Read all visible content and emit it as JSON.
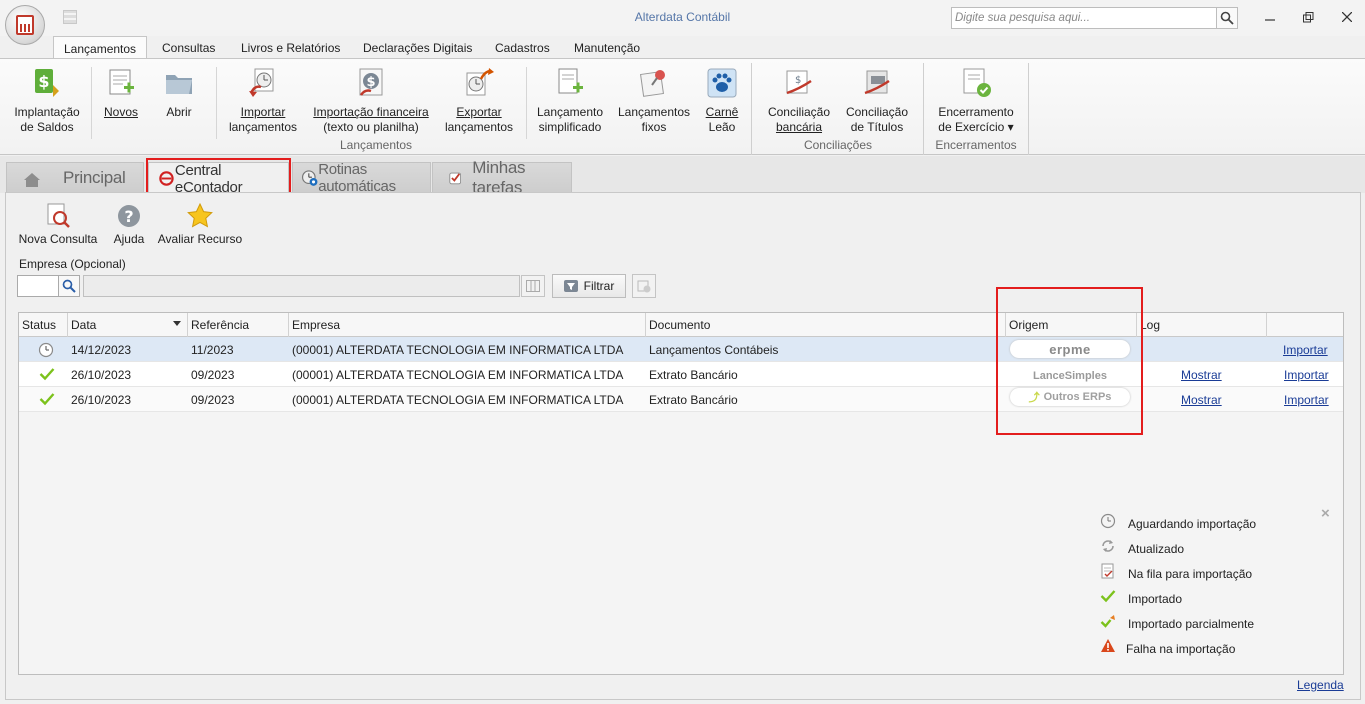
{
  "window": {
    "title": "Alterdata Contábil",
    "search_placeholder": "Digite sua pesquisa aqui..."
  },
  "ribbon_tabs": [
    "Lançamentos",
    "Consultas",
    "Livros e Relatórios",
    "Declarações Digitais",
    "Cadastros",
    "Manutenção"
  ],
  "ribbon": {
    "buttons": [
      {
        "line1": "Implantação",
        "line2": "de Saldos"
      },
      {
        "line1": "Novos",
        "line2": ""
      },
      {
        "line1": "Abrir",
        "line2": ""
      },
      {
        "line1": "Importar",
        "line2": "lançamentos"
      },
      {
        "line1": "Importação financeira",
        "line2": "(texto ou planilha)"
      },
      {
        "line1": "Exportar",
        "line2": "lançamentos"
      },
      {
        "line1": "Lançamento",
        "line2": "simplificado"
      },
      {
        "line1": "Lançamentos",
        "line2": "fixos"
      },
      {
        "line1": "Carnê",
        "line2": "Leão"
      },
      {
        "line1": "Conciliação",
        "line2": "bancária"
      },
      {
        "line1": "Conciliação",
        "line2": "de Títulos"
      },
      {
        "line1": "Encerramento",
        "line2": "de Exercício ▾"
      }
    ],
    "groups": [
      "Lançamentos",
      "Conciliações",
      "Encerramentos"
    ]
  },
  "doc_tabs": [
    "Principal",
    "Central eContador",
    "Rotinas automáticas",
    "Minhas tarefas"
  ],
  "toolbar": {
    "nova_consulta": "Nova Consulta",
    "ajuda": "Ajuda",
    "avaliar": "Avaliar Recurso"
  },
  "filter": {
    "empresa_label": "Empresa (Opcional)",
    "filtrar": "Filtrar"
  },
  "grid": {
    "columns": [
      "Status",
      "Data",
      "Referência",
      "Empresa",
      "Documento",
      "Origem",
      "Log"
    ],
    "rows": [
      {
        "status": "aguardando",
        "data": "14/12/2023",
        "referencia": "11/2023",
        "empresa": "(00001) ALTERDATA TECNOLOGIA EM INFORMATICA LTDA",
        "documento": "Lançamentos Contábeis",
        "origem": "erpme",
        "log": "",
        "acao": "Importar"
      },
      {
        "status": "importado",
        "data": "26/10/2023",
        "referencia": "09/2023",
        "empresa": "(00001) ALTERDATA TECNOLOGIA EM INFORMATICA LTDA",
        "documento": "Extrato Bancário",
        "origem": "LanceSimples",
        "log": "Mostrar",
        "acao": "Importar"
      },
      {
        "status": "importado",
        "data": "26/10/2023",
        "referencia": "09/2023",
        "empresa": "(00001) ALTERDATA TECNOLOGIA EM INFORMATICA LTDA",
        "documento": "Extrato Bancário",
        "origem": "Outros ERPs",
        "log": "Mostrar",
        "acao": "Importar"
      }
    ]
  },
  "origem_logos": {
    "erpme": "erpme",
    "lance": "LanceSimples",
    "outros": "Outros ERPs"
  },
  "legend": {
    "items": [
      {
        "icon": "clock-icon",
        "label": "Aguardando importação"
      },
      {
        "icon": "refresh-icon",
        "label": "Atualizado"
      },
      {
        "icon": "queue-icon",
        "label": "Na fila para importação"
      },
      {
        "icon": "check-icon",
        "label": "Importado"
      },
      {
        "icon": "partial-check-icon",
        "label": "Importado parcialmente"
      },
      {
        "icon": "warning-icon",
        "label": "Falha na importação"
      }
    ],
    "link": "Legenda"
  },
  "colors": {
    "highlight_red": "#e31d1d",
    "link_blue": "#1a3c96",
    "check_green": "#7cc21c",
    "selected_row": "#dde8f5"
  }
}
